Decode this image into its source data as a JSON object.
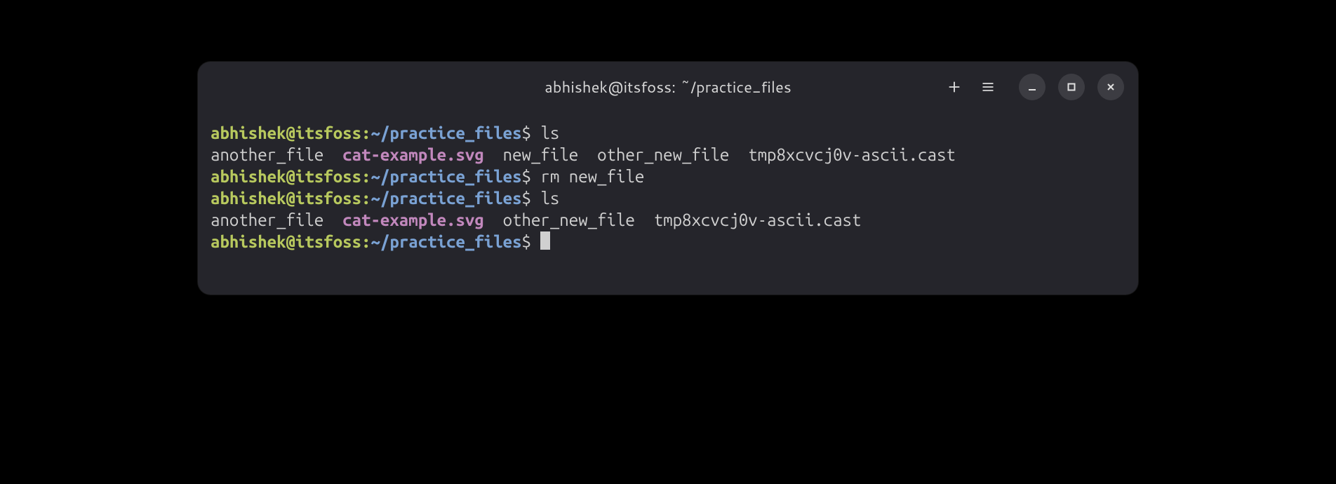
{
  "titlebar": {
    "title": "abhishek@itsfoss: ~/practice_files"
  },
  "prompt": {
    "user_host": "abhishek@itsfoss",
    "colon": ":",
    "path": "~/practice_files",
    "dollar": "$"
  },
  "commands": {
    "ls": "ls",
    "rm": "rm new_file"
  },
  "listing1": {
    "f1": "another_file",
    "f2": "cat-example.svg",
    "f3": "new_file",
    "f4": "other_new_file",
    "f5": "tmp8xcvcj0v-ascii.cast"
  },
  "listing2": {
    "f1": "another_file",
    "f2": "cat-example.svg",
    "f3": "other_new_file",
    "f4": "tmp8xcvcj0v-ascii.cast"
  }
}
